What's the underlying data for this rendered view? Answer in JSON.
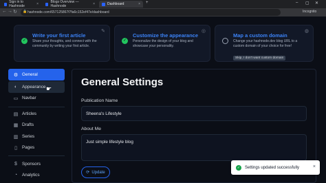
{
  "browser": {
    "tabs": [
      {
        "label": "Sign in to Hashnode"
      },
      {
        "label": "Blogs Overview — Hashnode"
      },
      {
        "label": "Dashboard"
      }
    ],
    "url": "hashnode.com/657125867f7fa6c152ef47e/dashboard",
    "profile_label": "Incognito",
    "new_tab": "+"
  },
  "onboarding_cards": [
    {
      "title": "Write your first article",
      "description": "Share your thoughts, and connect with the community by writing your first article.",
      "done": true
    },
    {
      "title": "Customize the appearance",
      "description": "Personalize the design of your blog and showcase your personality.",
      "done": true
    },
    {
      "title": "Map a custom domain",
      "description": "Change your hashnode.dev blog URL to a custom domain of your choice for free!",
      "done": false,
      "action": "Skip, I don't want custom domain"
    }
  ],
  "sidebar": {
    "items": [
      {
        "label": "General",
        "icon": "gear-icon",
        "glyph": "⚙"
      },
      {
        "label": "Appearance",
        "icon": "palette-icon",
        "glyph": "◐"
      },
      {
        "label": "Navbar",
        "icon": "navbar-icon",
        "glyph": "▭"
      },
      {
        "label": "Articles",
        "icon": "document-icon",
        "glyph": "▤"
      },
      {
        "label": "Drafts",
        "icon": "drafts-icon",
        "glyph": "▦"
      },
      {
        "label": "Series",
        "icon": "series-icon",
        "glyph": "▥"
      },
      {
        "label": "Pages",
        "icon": "pages-icon",
        "glyph": "▯"
      },
      {
        "label": "Sponsors",
        "icon": "dollar-icon",
        "glyph": "$"
      },
      {
        "label": "Analytics",
        "icon": "analytics-icon",
        "glyph": "◔"
      }
    ]
  },
  "main": {
    "title": "General Settings",
    "publication_name_label": "Publication Name",
    "publication_name_value": "Sheena's Lifestyle",
    "about_label": "About Me",
    "about_value": "Just simple lifestyle blog",
    "update_label": "Update"
  },
  "toast": {
    "message": "Settings updated successfully",
    "close": "×"
  },
  "colors": {
    "accent": "#2563eb",
    "success": "#22c55e",
    "background": "#0b0e16"
  }
}
